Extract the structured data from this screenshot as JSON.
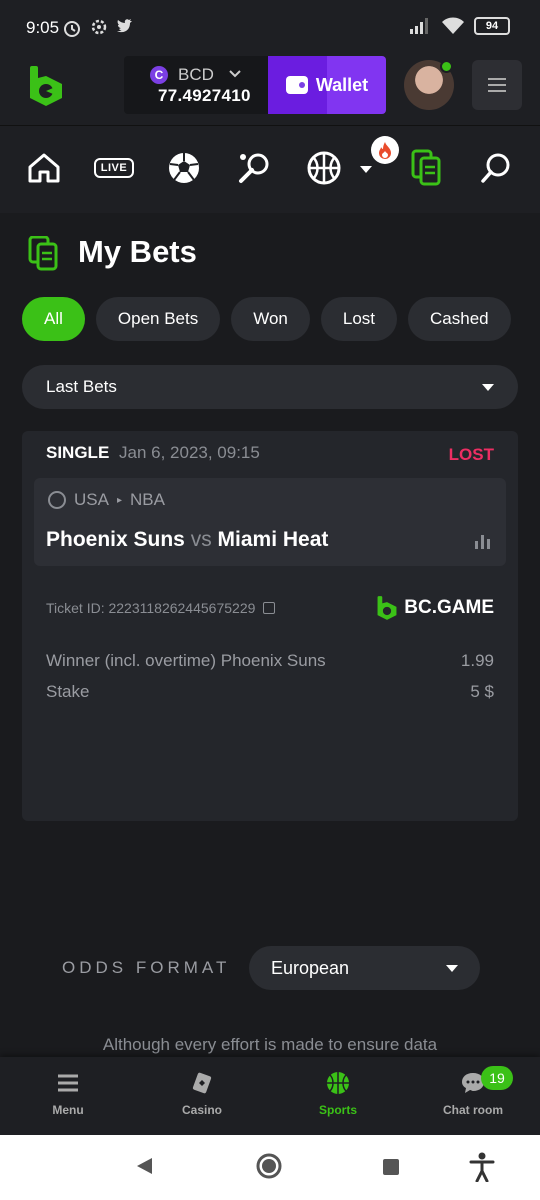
{
  "status_bar": {
    "time": "9:05",
    "battery": "94"
  },
  "header": {
    "currency": "BCD",
    "balance": "77.4927410",
    "wallet_label": "Wallet"
  },
  "nav": {
    "live_label": "LIVE"
  },
  "page": {
    "title": "My Bets",
    "tabs": [
      {
        "label": "All",
        "active": true
      },
      {
        "label": "Open Bets",
        "active": false
      },
      {
        "label": "Won",
        "active": false
      },
      {
        "label": "Lost",
        "active": false
      },
      {
        "label": "Cashed",
        "active": false
      }
    ],
    "filter_value": "Last Bets"
  },
  "bet": {
    "type": "SINGLE",
    "date": "Jan 6, 2023, 09:15",
    "status": "LOST",
    "country": "USA",
    "league": "NBA",
    "home": "Phoenix Suns",
    "vs": "vs",
    "away": "Miami Heat",
    "ticket_id": "Ticket ID: 2223118262445675229",
    "brand": "BC.GAME",
    "market": "Winner (incl. overtime) Phoenix Suns",
    "odds": "1.99",
    "stake_label": "Stake",
    "stake_value": "5 $"
  },
  "odds_format": {
    "label": "ODDS FORMAT",
    "value": "European"
  },
  "disclaimer": "Although every effort is made to ensure data",
  "bottom_nav": {
    "items": [
      {
        "label": "Menu"
      },
      {
        "label": "Casino"
      },
      {
        "label": "Sports"
      },
      {
        "label": "Chat room"
      }
    ],
    "chat_count": "19"
  },
  "colors": {
    "accent": "#3bc117",
    "lost": "#ed2e63",
    "wallet": "#7b3fe4"
  }
}
